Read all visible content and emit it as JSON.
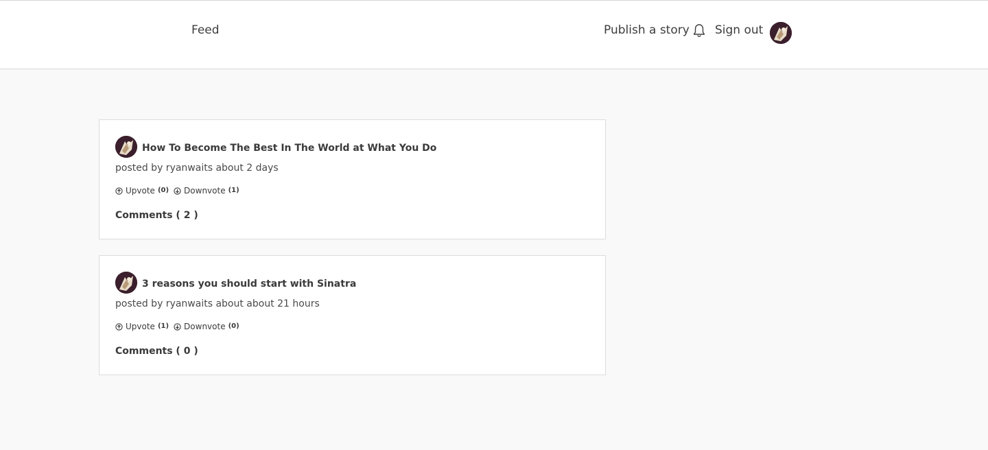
{
  "nav": {
    "feed_label": "Feed",
    "publish_label": "Publish a story",
    "signout_label": "Sign out",
    "bell_icon": "bell-icon",
    "avatar_icon": "user-avatar"
  },
  "posts": [
    {
      "title": "How To Become The Best In The World at What You Do",
      "meta": "posted by ryanwaits about 2 days",
      "upvote_label": "Upvote",
      "upvote_count": "(0)",
      "downvote_label": "Downvote",
      "downvote_count": "(1)",
      "comments_label": "Comments ( 2 )"
    },
    {
      "title": "3 reasons you should start with Sinatra",
      "meta": "posted by ryanwaits about about 21 hours",
      "upvote_label": "Upvote",
      "upvote_count": "(1)",
      "downvote_label": "Downvote",
      "downvote_count": "(0)",
      "comments_label": "Comments ( 0 )"
    }
  ],
  "colors": {
    "page_background": "#f9f9f9",
    "card_background": "#ffffff",
    "border": "#dcdcdc",
    "text": "#3a3a3a",
    "avatar_background": "#3b1f2c"
  }
}
